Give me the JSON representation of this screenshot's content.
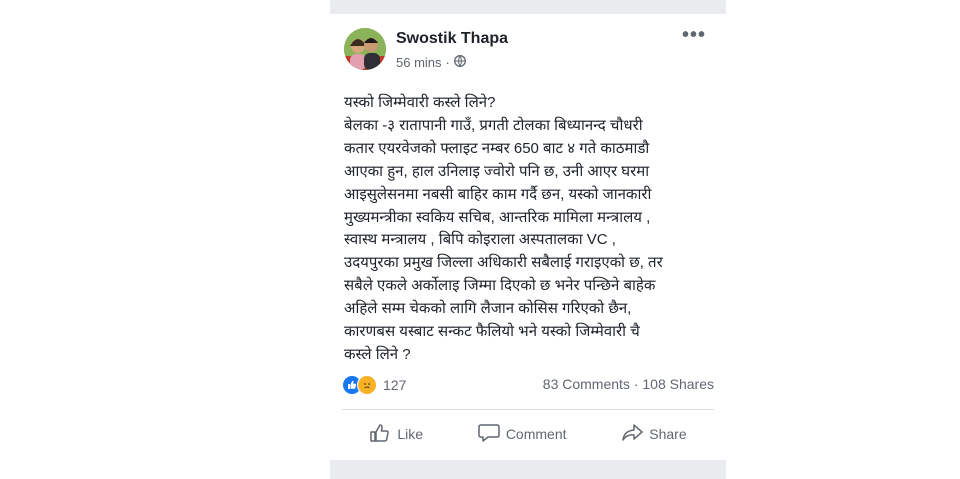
{
  "post": {
    "author": "Swostik Thapa",
    "time": "56 mins",
    "separator": "·",
    "more_label": "•••",
    "body_lines": [
      "यस्को जिम्मेवारी कस्ले लिने?",
      "बेलका -३ रातापानी गाउँ, प्रगती टोलका बिध्यानन्द चौधरी",
      "कतार एयरवेजको फ्लाइट नम्बर 650 बाट ४ गते काठमाडौ",
      "आएका हुन, हाल उनिलाइ ज्वोरो पनि छ, उनी आएर घरमा",
      "आइसुलेसनमा नबसी बाहिर काम गर्दै छन, यस्को जानकारी",
      "मुख्यमन्त्रीका स्वकिय सचिब, आन्तरिक मामिला मन्त्रालय ,",
      "स्वास्थ मन्त्रालय , बिपि कोइराला अस्पतालका VC ,",
      "उदयपुरका प्रमुख जिल्ला अधिकारी सबैलाई गराइएको छ, तर",
      "सबैले एकले अर्कोलाइ जिम्मा दिएको छ भनेर पन्छिने बाहेक",
      "अहिले सम्म चेकको लागि लैजान कोसिस गरिएको छैन,",
      "कारणबस यस्बाट सन्कट फैलियो भने यस्को जिम्मेवारी चै",
      "कस्ले लिने ?"
    ]
  },
  "stats": {
    "reaction_count": "127",
    "comments": "83 Comments",
    "dot": "·",
    "shares": "108 Shares"
  },
  "actions": {
    "like": "Like",
    "comment": "Comment",
    "share": "Share"
  },
  "icons": [
    "globe-icon",
    "like-reaction-icon",
    "sad-reaction-icon",
    "thumbs-up-icon",
    "comment-icon",
    "share-icon",
    "more-icon"
  ],
  "colors": {
    "like_blue": "#1877f2",
    "sad_yellow": "#f7b125",
    "text": "#1d2129",
    "muted": "#616770"
  }
}
